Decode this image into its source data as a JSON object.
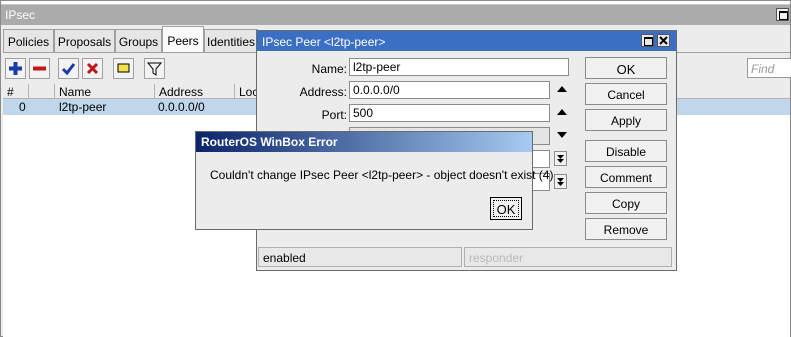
{
  "main_window": {
    "title": "IPsec",
    "tabs": [
      "Policies",
      "Proposals",
      "Groups",
      "Peers",
      "Identities"
    ],
    "active_tab": "Peers",
    "find_placeholder": "Find",
    "toolbar_icons": [
      "add-icon",
      "remove-icon",
      "enable-icon",
      "disable-icon",
      "comment-icon",
      "filter-icon"
    ],
    "columns": [
      "#",
      "Name",
      "Address",
      "Loca"
    ],
    "rows": [
      {
        "num": "0",
        "name": "l2tp-peer",
        "address": "0.0.0.0/0"
      }
    ]
  },
  "peer_dialog": {
    "title": "IPsec Peer <l2tp-peer>",
    "fields": {
      "name": {
        "label": "Name:",
        "value": "l2tp-peer"
      },
      "address": {
        "label": "Address:",
        "value": "0.0.0.0/0"
      },
      "port": {
        "label": "Port:",
        "value": "500"
      }
    },
    "buttons": {
      "ok": "OK",
      "cancel": "Cancel",
      "apply": "Apply",
      "disable": "Disable",
      "comment": "Comment",
      "copy": "Copy",
      "remove": "Remove"
    },
    "status_left": "enabled",
    "status_right": "responder"
  },
  "error_dialog": {
    "title": "RouterOS WinBox Error",
    "message": "Couldn't change IPsec Peer <l2tp-peer> - object doesn't exist (4)",
    "ok_label": "OK"
  },
  "colors": {
    "peer_title": "#3b6fc4",
    "selected_row": "#c0d6ea",
    "error_title_start": "#0a246a",
    "error_title_end": "#a6caf0"
  }
}
